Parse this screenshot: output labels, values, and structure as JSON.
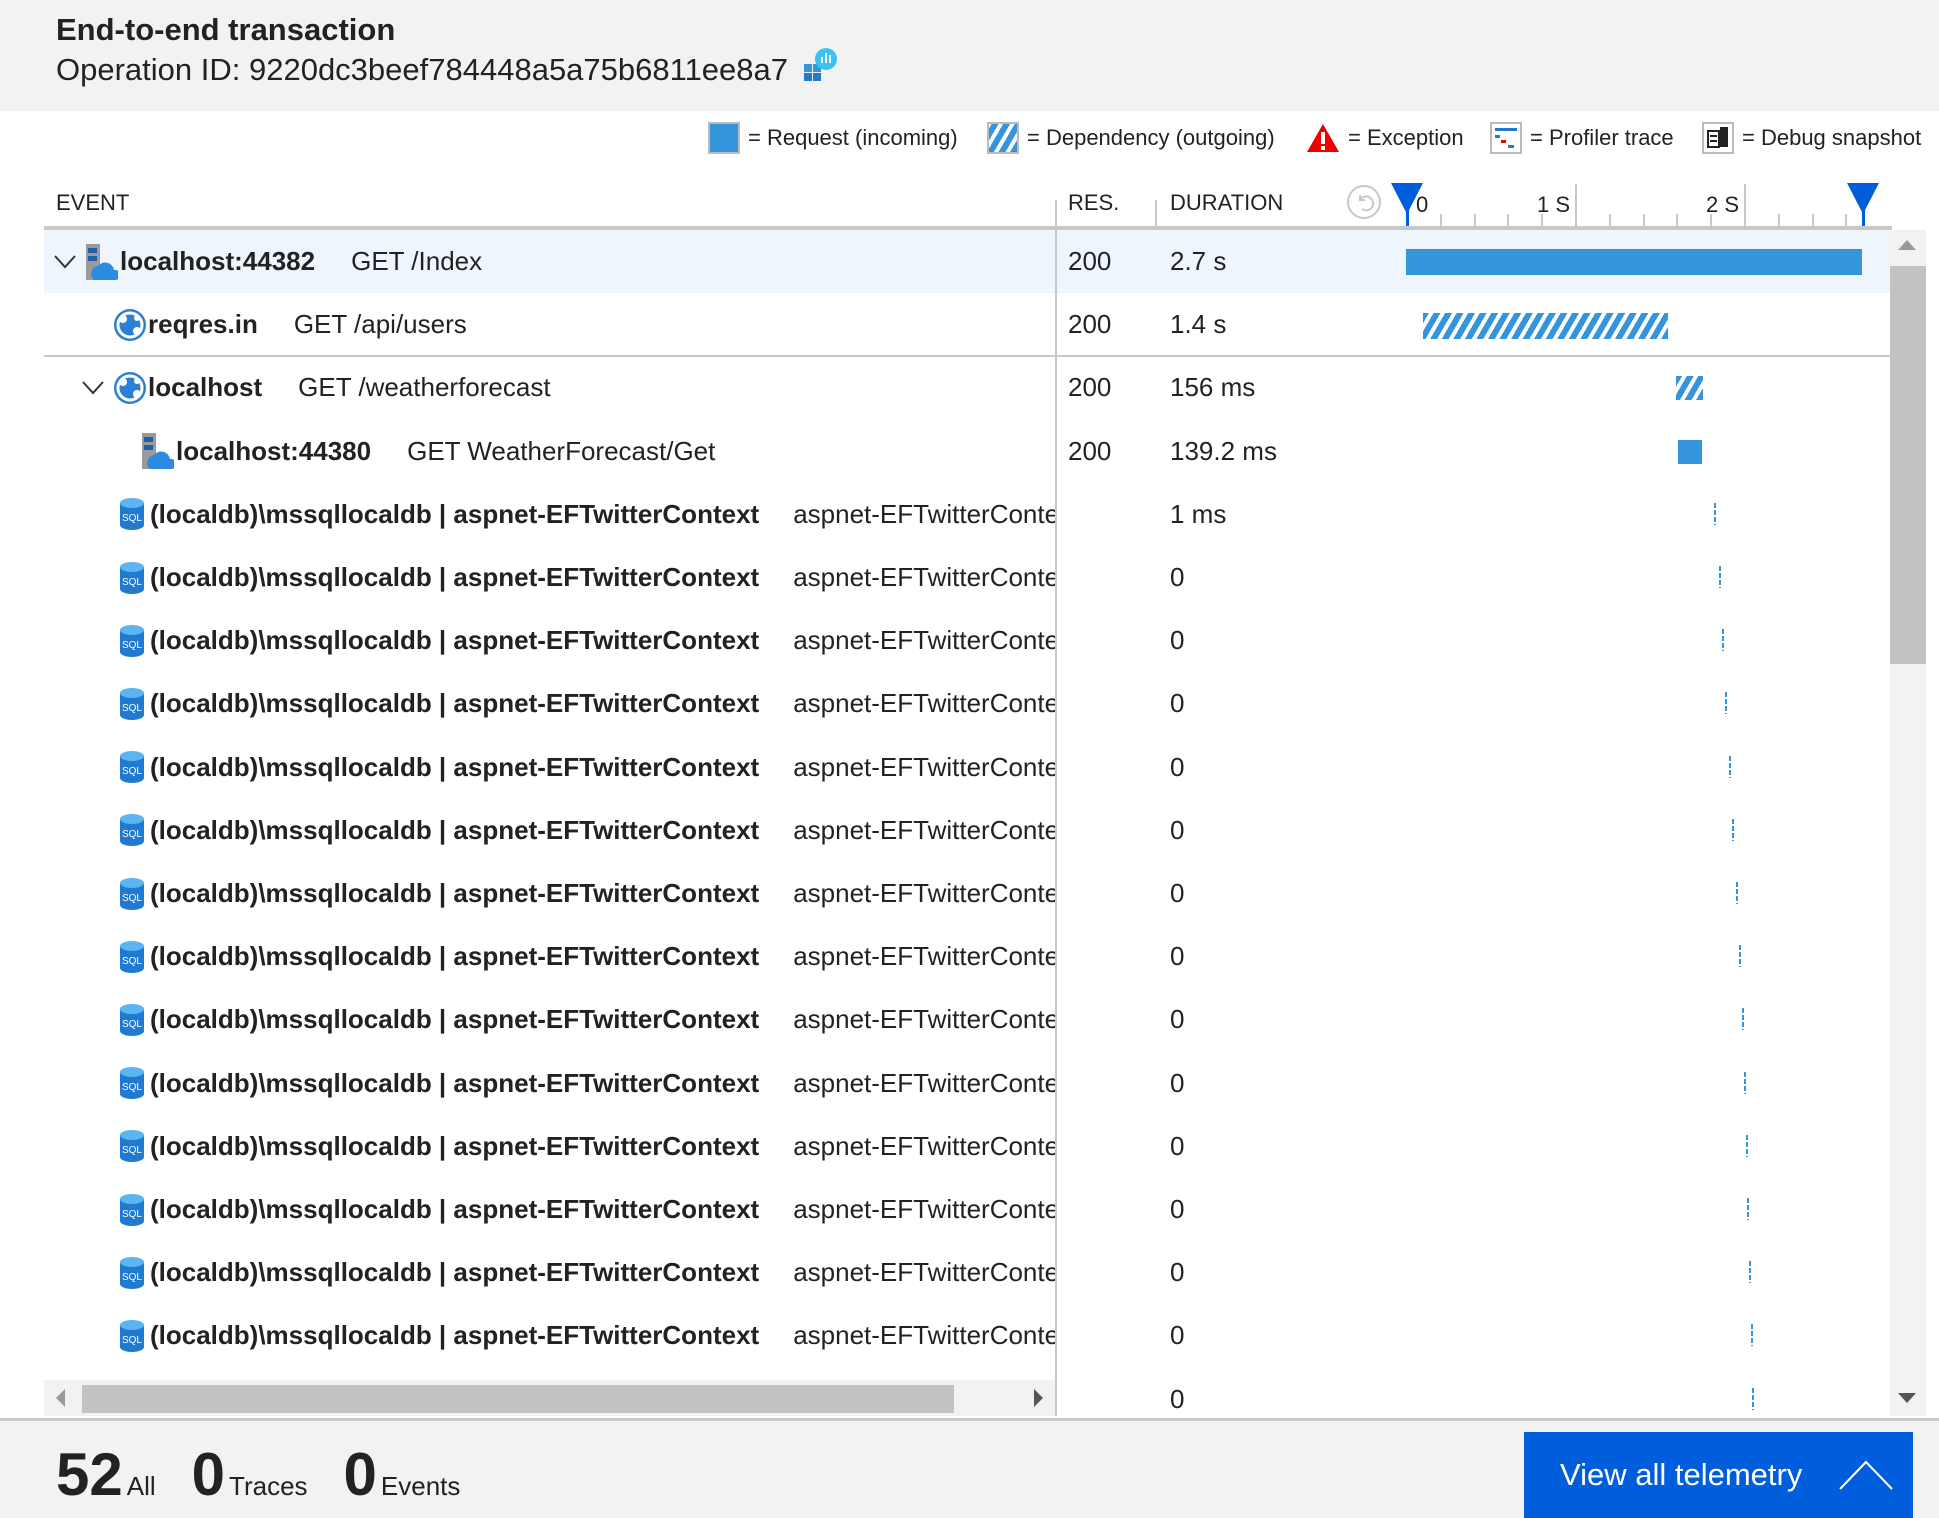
{
  "header": {
    "title": "End-to-end transaction",
    "operation_id": "Operation ID: 9220dc3beef784448a5a75b6811ee8a7",
    "icon": "app-insights-icon"
  },
  "legend": [
    {
      "icon": "request-swatch",
      "label": "= Request (incoming)"
    },
    {
      "icon": "dependency-swatch",
      "label": "= Dependency (outgoing)"
    },
    {
      "icon": "exception-icon",
      "label": "= Exception"
    },
    {
      "icon": "profiler-trace-icon",
      "label": "= Profiler trace"
    },
    {
      "icon": "debug-snapshot-icon",
      "label": "= Debug snapshot"
    }
  ],
  "columns": {
    "event": "EVENT",
    "res": "RES.",
    "duration": "DURATION"
  },
  "timeline": {
    "ticks": [
      "0",
      "1 S",
      "2 S"
    ],
    "range_s": [
      0,
      2.7
    ],
    "colors": {
      "bar": "#3595dc",
      "marker": "#005ddb"
    }
  },
  "rows": [
    {
      "indent": 0,
      "chev": true,
      "icon": "server-cloud-icon",
      "name": "localhost:44382",
      "detail": "GET /Index",
      "res": "200",
      "duration": "2.7 s",
      "type": "request",
      "start": 0,
      "dur": 2.7,
      "selected": true
    },
    {
      "indent": 1,
      "chev": false,
      "icon": "globe-icon",
      "name": "reqres.in",
      "detail": "GET /api/users",
      "res": "200",
      "duration": "1.4 s",
      "type": "dependency",
      "start": 0.1,
      "dur": 1.45
    },
    {
      "indent": 1,
      "chev": true,
      "icon": "globe-icon",
      "name": "localhost",
      "detail": "GET /weatherforecast",
      "res": "200",
      "duration": "156 ms",
      "type": "dependency",
      "start": 1.6,
      "dur": 0.156
    },
    {
      "indent": 2,
      "chev": false,
      "icon": "server-cloud-icon",
      "name": "localhost:44380",
      "detail": "GET WeatherForecast/Get",
      "res": "200",
      "duration": "139.2 ms",
      "type": "request",
      "start": 1.61,
      "dur": 0.139
    },
    {
      "indent": 1,
      "icon": "sql-icon",
      "name": "(localdb)\\mssqllocaldb | aspnet-EFTwitterContext",
      "detail": "aspnet-EFTwitterContext",
      "res": "",
      "duration": "1 ms",
      "type": "sql",
      "start": 1.82
    },
    {
      "indent": 1,
      "icon": "sql-icon",
      "name": "(localdb)\\mssqllocaldb | aspnet-EFTwitterContext",
      "detail": "aspnet-EFTwitterContext",
      "res": "",
      "duration": "0",
      "type": "sql",
      "start": 1.85
    },
    {
      "indent": 1,
      "icon": "sql-icon",
      "name": "(localdb)\\mssqllocaldb | aspnet-EFTwitterContext",
      "detail": "aspnet-EFTwitterContext",
      "res": "",
      "duration": "0",
      "type": "sql",
      "start": 1.87
    },
    {
      "indent": 1,
      "icon": "sql-icon",
      "name": "(localdb)\\mssqllocaldb | aspnet-EFTwitterContext",
      "detail": "aspnet-EFTwitterContext",
      "res": "",
      "duration": "0",
      "type": "sql",
      "start": 1.89
    },
    {
      "indent": 1,
      "icon": "sql-icon",
      "name": "(localdb)\\mssqllocaldb | aspnet-EFTwitterContext",
      "detail": "aspnet-EFTwitterContext",
      "res": "",
      "duration": "0",
      "type": "sql",
      "start": 1.91
    },
    {
      "indent": 1,
      "icon": "sql-icon",
      "name": "(localdb)\\mssqllocaldb | aspnet-EFTwitterContext",
      "detail": "aspnet-EFTwitterContext",
      "res": "",
      "duration": "0",
      "type": "sql",
      "start": 1.93
    },
    {
      "indent": 1,
      "icon": "sql-icon",
      "name": "(localdb)\\mssqllocaldb | aspnet-EFTwitterContext",
      "detail": "aspnet-EFTwitterContext",
      "res": "",
      "duration": "0",
      "type": "sql",
      "start": 1.95
    },
    {
      "indent": 1,
      "icon": "sql-icon",
      "name": "(localdb)\\mssqllocaldb | aspnet-EFTwitterContext",
      "detail": "aspnet-EFTwitterContext",
      "res": "",
      "duration": "0",
      "type": "sql",
      "start": 1.97
    },
    {
      "indent": 1,
      "icon": "sql-icon",
      "name": "(localdb)\\mssqllocaldb | aspnet-EFTwitterContext",
      "detail": "aspnet-EFTwitterContext",
      "res": "",
      "duration": "0",
      "type": "sql",
      "start": 1.99
    },
    {
      "indent": 1,
      "icon": "sql-icon",
      "name": "(localdb)\\mssqllocaldb | aspnet-EFTwitterContext",
      "detail": "aspnet-EFTwitterContext",
      "res": "",
      "duration": "0",
      "type": "sql",
      "start": 2.0
    },
    {
      "indent": 1,
      "icon": "sql-icon",
      "name": "(localdb)\\mssqllocaldb | aspnet-EFTwitterContext",
      "detail": "aspnet-EFTwitterContext",
      "res": "",
      "duration": "0",
      "type": "sql",
      "start": 2.01
    },
    {
      "indent": 1,
      "icon": "sql-icon",
      "name": "(localdb)\\mssqllocaldb | aspnet-EFTwitterContext",
      "detail": "aspnet-EFTwitterContext",
      "res": "",
      "duration": "0",
      "type": "sql",
      "start": 2.02
    },
    {
      "indent": 1,
      "icon": "sql-icon",
      "name": "(localdb)\\mssqllocaldb | aspnet-EFTwitterContext",
      "detail": "aspnet-EFTwitterContext",
      "res": "",
      "duration": "0",
      "type": "sql",
      "start": 2.03
    },
    {
      "indent": 1,
      "icon": "sql-icon",
      "name": "(localdb)\\mssqllocaldb | aspnet-EFTwitterContext",
      "detail": "aspnet-EFTwitterContext",
      "res": "",
      "duration": "0",
      "type": "sql",
      "start": 2.04
    },
    {
      "indent": 1,
      "icon": "sql-icon",
      "name": "",
      "detail": "",
      "res": "",
      "duration": "0",
      "type": "sql",
      "start": 2.05
    }
  ],
  "footer": {
    "all_count": "52",
    "all_label": "All",
    "traces_count": "0",
    "traces_label": "Traces",
    "events_count": "0",
    "events_label": "Events",
    "view_all": "View all telemetry"
  }
}
